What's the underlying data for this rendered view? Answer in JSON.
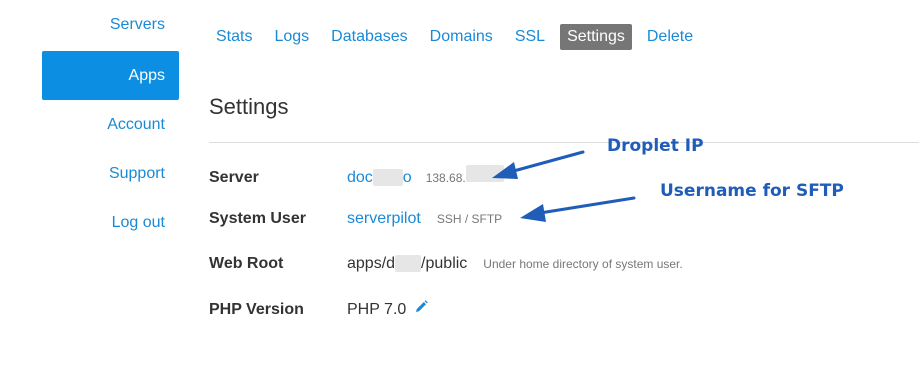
{
  "sidebar": {
    "items": [
      {
        "label": "Servers"
      },
      {
        "label": "Apps"
      },
      {
        "label": "Account"
      },
      {
        "label": "Support"
      },
      {
        "label": "Log out"
      }
    ]
  },
  "tabs": [
    {
      "label": "Stats"
    },
    {
      "label": "Logs"
    },
    {
      "label": "Databases"
    },
    {
      "label": "Domains"
    },
    {
      "label": "SSL"
    },
    {
      "label": "Settings",
      "active": true
    },
    {
      "label": "Delete"
    }
  ],
  "page": {
    "title": "Settings"
  },
  "settings": {
    "server": {
      "label": "Server",
      "value": "doc",
      "value_tail": "o",
      "ip": "138.68."
    },
    "system_user": {
      "label": "System User",
      "value": "serverpilot",
      "meta": "SSH / SFTP"
    },
    "web_root": {
      "label": "Web Root",
      "value_prefix": "apps/d",
      "value_suffix": "/public",
      "meta": "Under home directory of system user."
    },
    "php_version": {
      "label": "PHP Version",
      "value": "PHP 7.0"
    }
  },
  "annotations": {
    "droplet_ip": "Droplet IP",
    "sftp_user": "Username for SFTP"
  },
  "colors": {
    "link": "#1a8ad6",
    "active_sidebar": "#0c8fe2",
    "active_tab": "#767676",
    "annotation": "#1f5db8"
  },
  "icons": {
    "edit": "pencil-icon"
  }
}
